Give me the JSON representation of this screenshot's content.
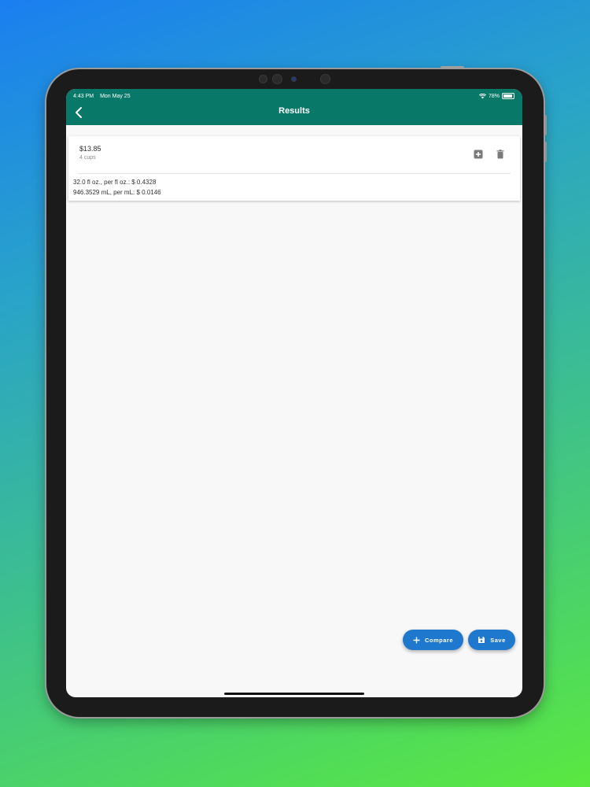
{
  "status_bar": {
    "time": "4:43 PM",
    "date": "Mon May 25",
    "battery": "78%",
    "battery_level": 0.78
  },
  "header": {
    "title": "Results",
    "back_icon": "chevron-left-icon"
  },
  "result_card": {
    "price": "$13.85",
    "quantity": "4 cups",
    "actions": [
      {
        "icon": "add-box-icon"
      },
      {
        "icon": "trash-icon"
      }
    ],
    "details": [
      "32.0 fl oz., per fl oz.: $ 0.4328",
      "946.3529 mL, per mL: $ 0.0146"
    ]
  },
  "fab": {
    "compare_label": "Compare",
    "save_label": "Save"
  },
  "colors": {
    "app_bar": "#087868",
    "fab": "#1e78cd",
    "background": "#f8f8f9"
  }
}
